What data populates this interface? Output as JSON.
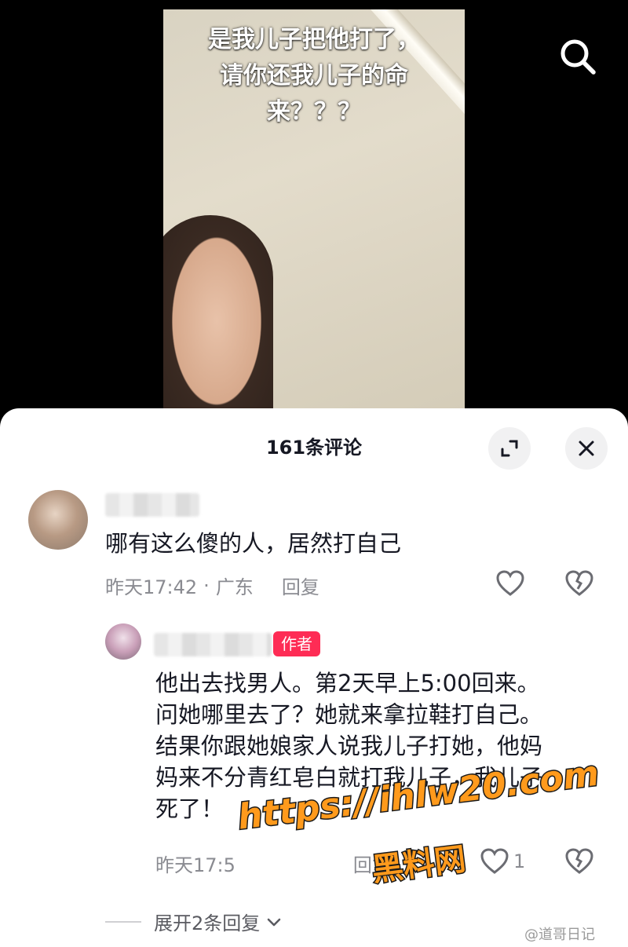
{
  "video": {
    "caption_lines": [
      "是我儿子把他打了，",
      "请你还我儿子的命",
      "来？？？"
    ]
  },
  "panel": {
    "title": "161条评论"
  },
  "comments": [
    {
      "text": "哪有这么傻的人，居然打自己",
      "time": "昨天17:42",
      "location": "广东",
      "separator": "·",
      "reply_label": "回复"
    },
    {
      "badge": "作者",
      "text_lines": [
        "他出去找男人。第2天早上5:00回来。",
        "问她哪里去了？她就来拿拉鞋打自己。",
        "结果你跟她娘家人说我儿子打她，他妈",
        "妈来不分青红皂白就打我儿子，我儿子",
        "死了！"
      ],
      "time": "昨天17:5",
      "reply_label": "回复",
      "like_count": "1"
    }
  ],
  "expand_replies_label": "展开2条回复",
  "watermarks": {
    "url": "https://ihlw20.com",
    "site": "黑料网",
    "weibo": "@道哥日记"
  },
  "colors": {
    "accent": "#fe2c55",
    "watermark": "#ff9a1c",
    "meta_text": "#8a8b91"
  }
}
